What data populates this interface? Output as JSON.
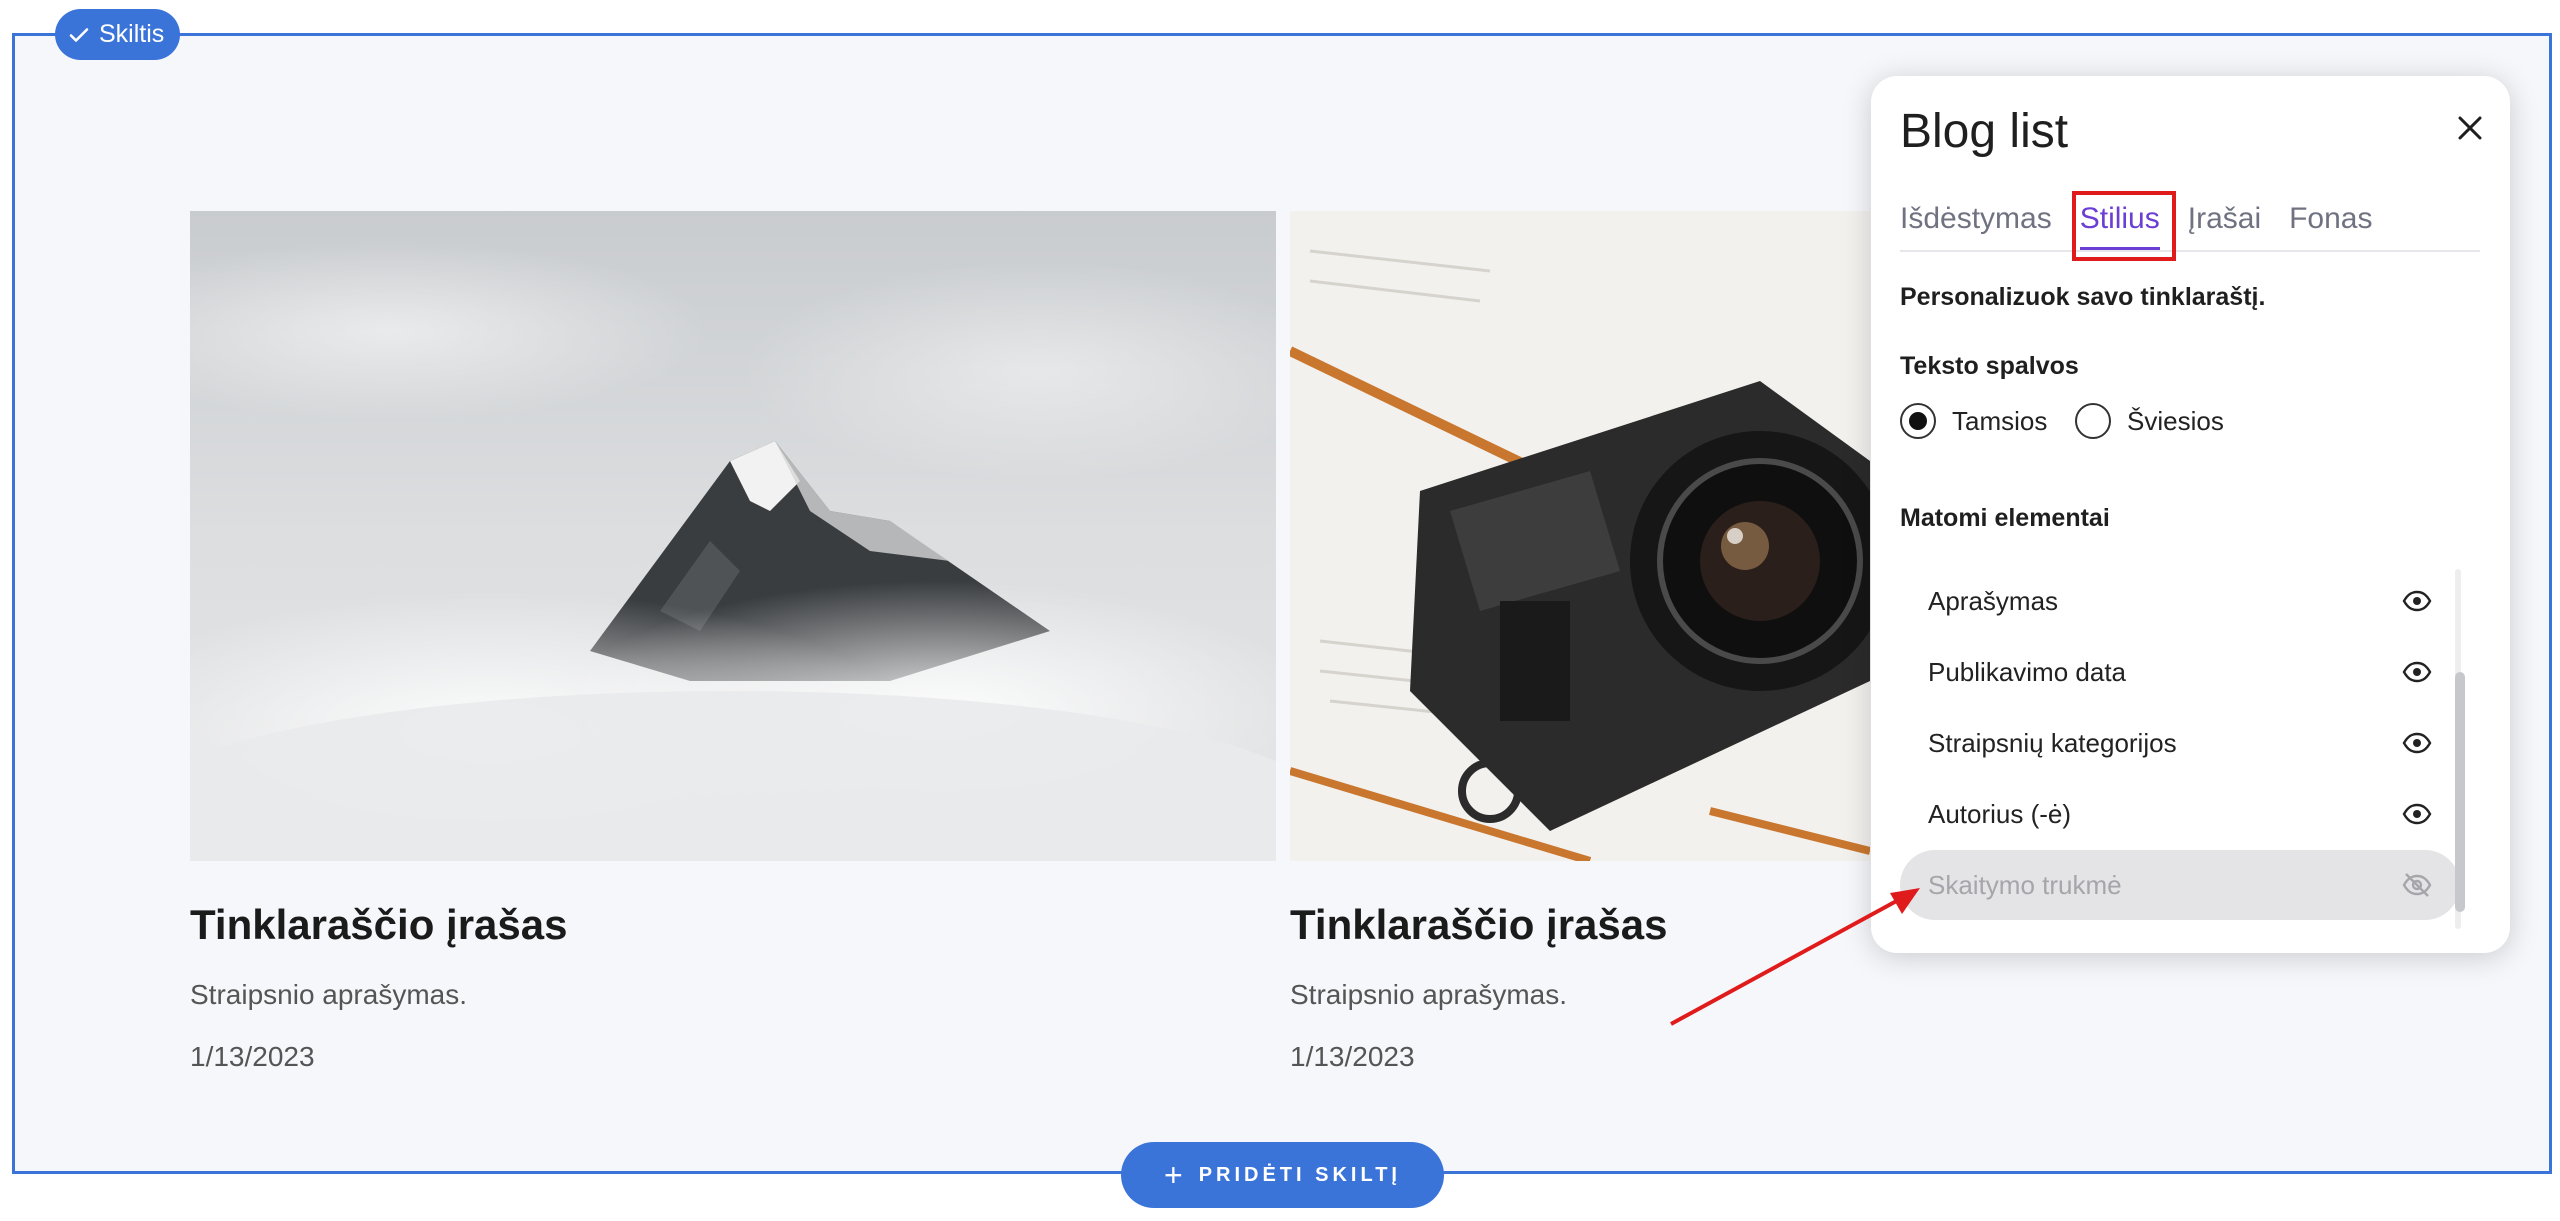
{
  "section": {
    "badge_label": "Skiltis",
    "add_button_label": "PRIDĖTI SKILTĮ"
  },
  "posts": [
    {
      "title": "Tinklaraščio įrašas",
      "description": "Straipsnio aprašymas.",
      "date": "1/13/2023",
      "image": "misty-mountain-peak"
    },
    {
      "title": "Tinklaraščio įrašas",
      "description": "Straipsnio aprašymas.",
      "date": "1/13/2023",
      "image": "camera-on-book"
    }
  ],
  "panel": {
    "title": "Blog list",
    "tabs": [
      {
        "label": "Išdėstymas",
        "active": false
      },
      {
        "label": "Stilius",
        "active": true
      },
      {
        "label": "Įrašai",
        "active": false
      },
      {
        "label": "Fonas",
        "active": false
      }
    ],
    "subtitle": "Personalizuok savo tinklaraštį.",
    "text_colors": {
      "label": "Teksto spalvos",
      "options": [
        "Tamsios",
        "Šviesios"
      ],
      "selected": "Tamsios"
    },
    "visible_elements": {
      "label": "Matomi elementai",
      "items": [
        {
          "label": "Aprašymas",
          "visible": true
        },
        {
          "label": "Publikavimo data",
          "visible": true
        },
        {
          "label": "Straipsnių kategorijos",
          "visible": true
        },
        {
          "label": "Autorius (-ė)",
          "visible": true
        },
        {
          "label": "Skaitymo trukmė",
          "visible": false
        }
      ]
    }
  },
  "colors": {
    "accent": "#3b74d9",
    "tab_active": "#6b3fd4",
    "highlight": "#e01b1b",
    "section_bg": "#f6f7fb"
  }
}
